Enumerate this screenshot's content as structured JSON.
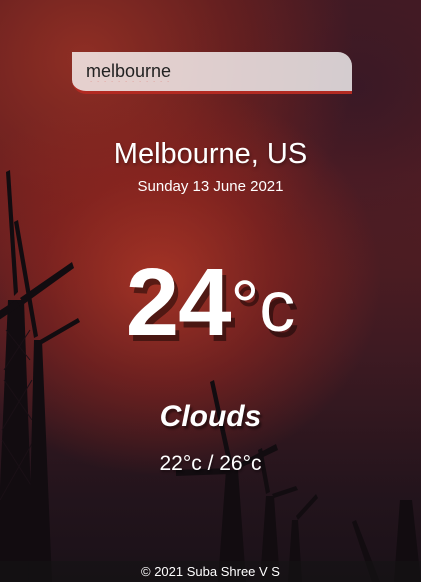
{
  "search": {
    "value": "melbourne"
  },
  "weather": {
    "location": "Melbourne, US",
    "date": "Sunday 13 June 2021",
    "temperature": "24",
    "unit": "°c",
    "condition": "Clouds",
    "hilo": "22°c / 26°c"
  },
  "footer": {
    "text": "© 2021 Suba Shree V S"
  },
  "colors": {
    "accent": "#b22a22",
    "text": "#ffffff"
  }
}
